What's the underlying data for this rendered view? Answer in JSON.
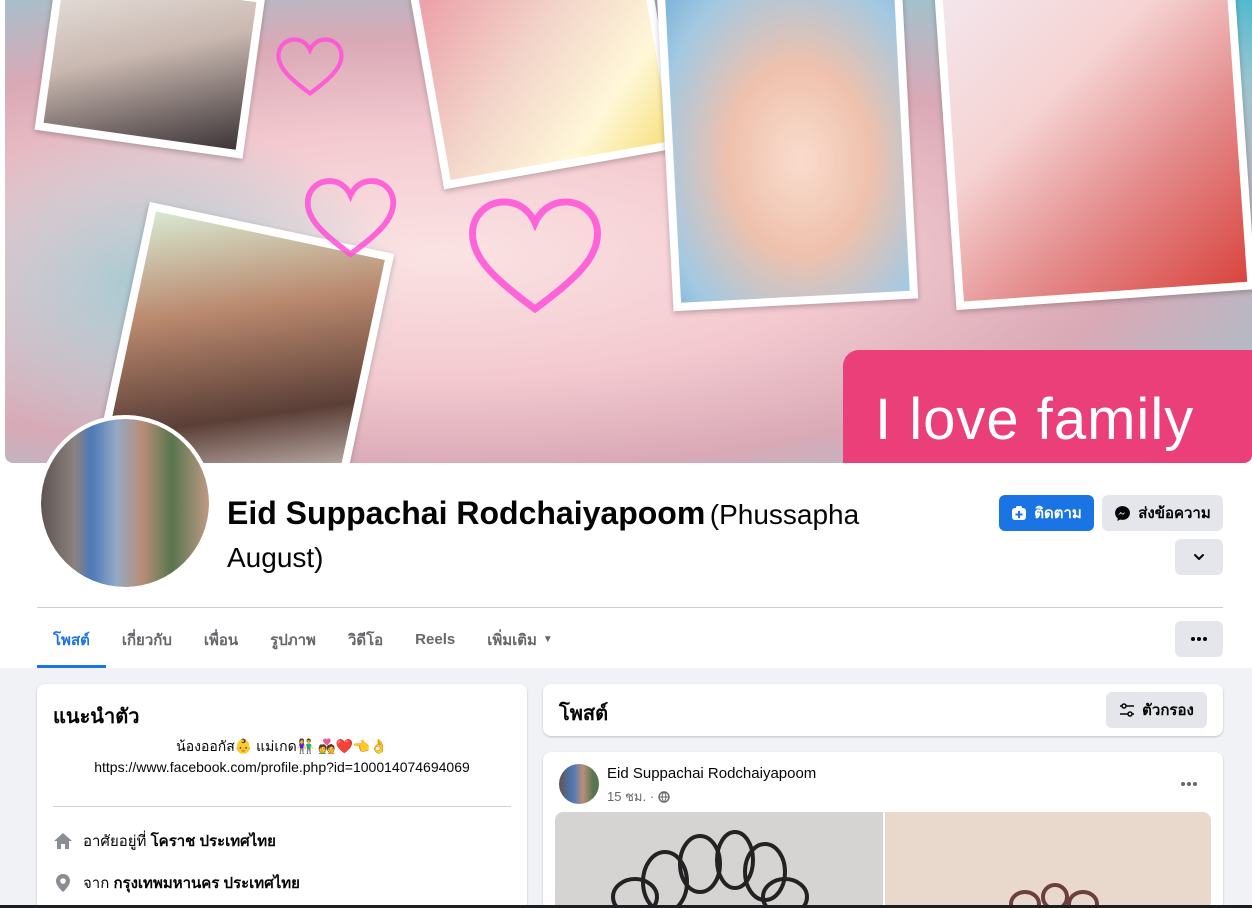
{
  "cover": {
    "banner_text": "I love family",
    "colors": {
      "banner": "#ea3f79",
      "heart": "#ff4fd8"
    }
  },
  "profile": {
    "name": "Eid Suppachai Rodchaiyapoom",
    "alternate_name": "(Phussapha August)"
  },
  "actions": {
    "follow_label": "ติดตาม",
    "message_label": "ส่งข้อความ",
    "follow_icon": "add-friend-icon",
    "message_icon": "messenger-icon"
  },
  "tabs": [
    {
      "label": "โพสต์",
      "active": true
    },
    {
      "label": "เกี่ยวกับ",
      "active": false
    },
    {
      "label": "เพื่อน",
      "active": false
    },
    {
      "label": "รูปภาพ",
      "active": false
    },
    {
      "label": "วิดีโอ",
      "active": false
    },
    {
      "label": "Reels",
      "active": false
    },
    {
      "label": "เพิ่มเติม",
      "active": false
    }
  ],
  "intro": {
    "title": "แนะนำตัว",
    "bio_line1": "น้องออกัส👶 แม่เกด👫 💑❤️👈👌",
    "bio_line2": "https://www.facebook.com/profile.php?id=100014074694069",
    "lives_prefix": "อาศัยอยู่ที่",
    "lives_value": "โคราช ประเทศไทย",
    "from_prefix": "จาก",
    "from_value": "กรุงเทพมหานคร ประเทศไทย"
  },
  "posts": {
    "title": "โพสต์",
    "filter_label": "ตัวกรอง"
  },
  "post": {
    "author": "Eid Suppachai Rodchaiyapoom",
    "time": "15 ชม. ·"
  },
  "theme": {
    "accent": "#1b74e4",
    "secondary_button": "#e4e6eb",
    "page_bg": "#f0f2f5",
    "muted_text": "#65676b"
  }
}
